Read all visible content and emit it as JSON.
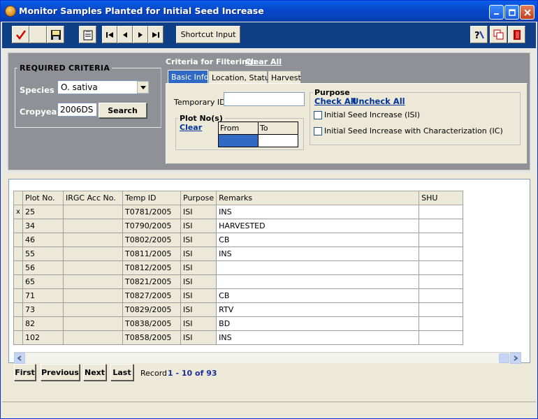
{
  "window": {
    "title": "Monitor Samples Planted for Initial Seed Increase"
  },
  "toolbar": {
    "shortcut_label": "Shortcut Input"
  },
  "required": {
    "title": "REQUIRED  CRITERIA",
    "species_label": "Species",
    "species_value": "O. sativa",
    "cropyear_label": "Cropyear",
    "cropyear_value": "2006DS",
    "search_label": "Search"
  },
  "criteria": {
    "label": "Criteria for Filtering:",
    "clear_all": "Clear All",
    "tabs": [
      {
        "label": "Basic Info"
      },
      {
        "label": "Location, Status"
      },
      {
        "label": "Harvest"
      }
    ],
    "temporary_id_label": "Temporary ID",
    "plot": {
      "title": "Plot No(s)",
      "clear": "Clear",
      "from": "From",
      "to": "To"
    },
    "purpose": {
      "title": "Purpose",
      "check_all": "Check All",
      "uncheck_all": "Uncheck All",
      "option1": "Initial Seed Increase (ISI)",
      "option2": "Initial Seed Increase with Characterization (IC)"
    }
  },
  "grid": {
    "columns": [
      "Plot No.",
      "IRGC Acc No.",
      "Temp ID",
      "Purpose",
      "Remarks",
      "SHU"
    ],
    "current_marker": "x",
    "rows": [
      {
        "plot": "25",
        "irgc": "",
        "temp": "T0781/2005",
        "purpose": "ISI",
        "remarks": "INS",
        "shu": ""
      },
      {
        "plot": "34",
        "irgc": "",
        "temp": "T0790/2005",
        "purpose": "ISI",
        "remarks": "HARVESTED",
        "shu": ""
      },
      {
        "plot": "46",
        "irgc": "",
        "temp": "T0802/2005",
        "purpose": "ISI",
        "remarks": "CB",
        "shu": ""
      },
      {
        "plot": "55",
        "irgc": "",
        "temp": "T0811/2005",
        "purpose": "ISI",
        "remarks": "INS",
        "shu": ""
      },
      {
        "plot": "56",
        "irgc": "",
        "temp": "T0812/2005",
        "purpose": "ISI",
        "remarks": "",
        "shu": ""
      },
      {
        "plot": "65",
        "irgc": "",
        "temp": "T0821/2005",
        "purpose": "ISI",
        "remarks": "",
        "shu": ""
      },
      {
        "plot": "71",
        "irgc": "",
        "temp": "T0827/2005",
        "purpose": "ISI",
        "remarks": "CB",
        "shu": ""
      },
      {
        "plot": "73",
        "irgc": "",
        "temp": "T0829/2005",
        "purpose": "ISI",
        "remarks": "RTV",
        "shu": ""
      },
      {
        "plot": "82",
        "irgc": "",
        "temp": "T0838/2005",
        "purpose": "ISI",
        "remarks": "BD",
        "shu": ""
      },
      {
        "plot": "102",
        "irgc": "",
        "temp": "T0858/2005",
        "purpose": "ISI",
        "remarks": "INS",
        "shu": ""
      }
    ]
  },
  "nav": {
    "first": "First",
    "previous": "Previous",
    "next": "Next",
    "last": "Last",
    "record_label": "Record",
    "record_value": "1 - 10 of 93"
  }
}
